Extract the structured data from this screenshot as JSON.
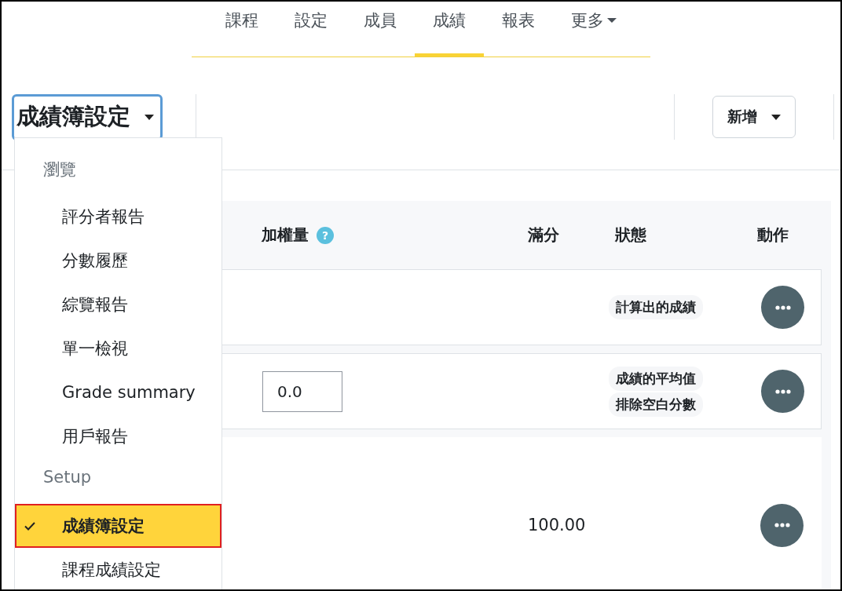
{
  "nav_tabs": [
    {
      "label": "課程",
      "selected": false,
      "kind": "link"
    },
    {
      "label": "設定",
      "selected": false,
      "kind": "link"
    },
    {
      "label": "成員",
      "selected": false,
      "kind": "link"
    },
    {
      "label": "成績",
      "selected": true,
      "kind": "link"
    },
    {
      "label": "報表",
      "selected": false,
      "kind": "link"
    },
    {
      "label": "更多",
      "selected": false,
      "kind": "menu"
    }
  ],
  "header": {
    "title_menu": "成績簿設定",
    "add_button": "新增"
  },
  "dropdown": {
    "sections": [
      {
        "heading": "瀏覽",
        "items": [
          {
            "label": "評分者報告",
            "selected": false
          },
          {
            "label": "分數履歷",
            "selected": false
          },
          {
            "label": "綜覽報告",
            "selected": false
          },
          {
            "label": "單一檢視",
            "selected": false
          },
          {
            "label": "Grade summary",
            "selected": false
          },
          {
            "label": "用戶報告",
            "selected": false
          }
        ]
      },
      {
        "heading": "Setup",
        "items": [
          {
            "label": "成績簿設定",
            "selected": true
          },
          {
            "label": "課程成績設定",
            "selected": false
          }
        ]
      }
    ]
  },
  "table": {
    "columns": [
      {
        "label": "加權量",
        "help": "?"
      },
      {
        "label": "滿分"
      },
      {
        "label": "狀態"
      },
      {
        "label": "動作"
      }
    ],
    "rows": [
      {
        "kind": "category",
        "statuses": [
          "計算出的成績"
        ]
      },
      {
        "kind": "category",
        "weight": "0.0",
        "statuses": [
          "成績的平均值",
          "排除空白分數"
        ]
      },
      {
        "kind": "item",
        "max": "100.00",
        "statuses": []
      }
    ]
  }
}
